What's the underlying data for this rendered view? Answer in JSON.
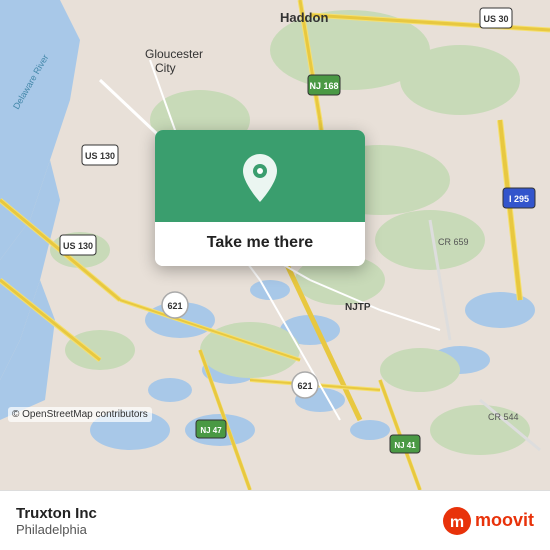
{
  "map": {
    "attribution": "© OpenStreetMap contributors"
  },
  "popup": {
    "label": "Take me there",
    "pin_icon": "location-pin"
  },
  "bottom_bar": {
    "title": "Truxton Inc",
    "subtitle": "Philadelphia",
    "logo_text": "moovit"
  }
}
